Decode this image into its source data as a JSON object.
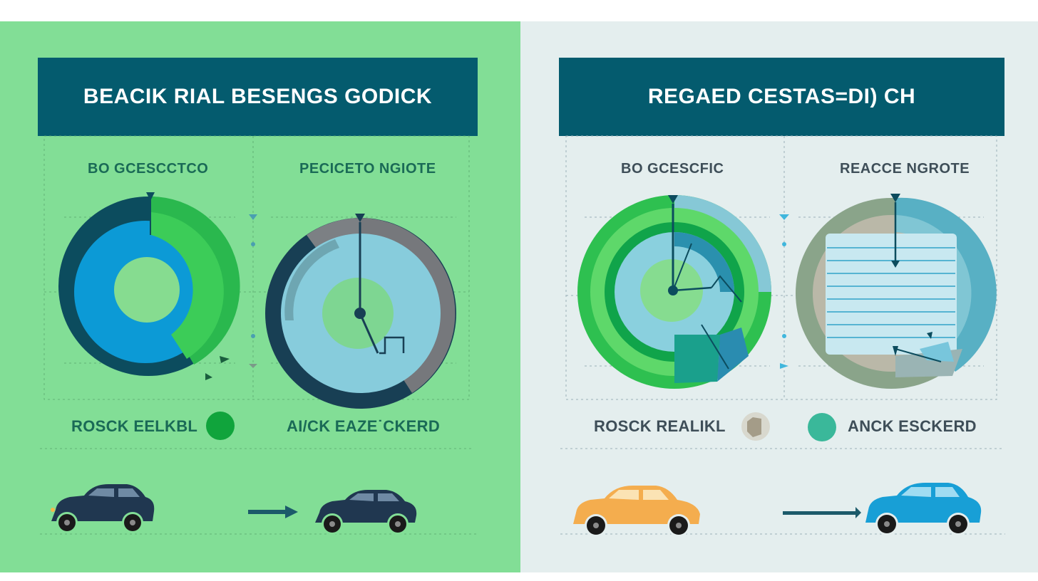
{
  "left": {
    "title": "BEACIK RIAL BESENGS GODICK",
    "gauge_a_label": "BO GCESCCTCO",
    "gauge_b_label": "PECICETO NGIOTE",
    "legend_a_label": "ROSCK EELKBL",
    "legend_b_label": "ΑΙ/CK EAZE˙CKERD",
    "legend_a_color": "#10a43c",
    "car_colors": [
      "#203750",
      "#203750"
    ]
  },
  "right": {
    "title": "REGAED CESTAS=DI) CH",
    "gauge_a_label": "BO GCESCFIC",
    "gauge_b_label": "REACCE NGROTE",
    "legend_a_label": "ROSCK REALIKL",
    "legend_b_label": "ANCK ESCKERD",
    "legend_b_color": "#3ab89a",
    "car_colors": [
      "#f4ad4e",
      "#189fd6"
    ]
  }
}
